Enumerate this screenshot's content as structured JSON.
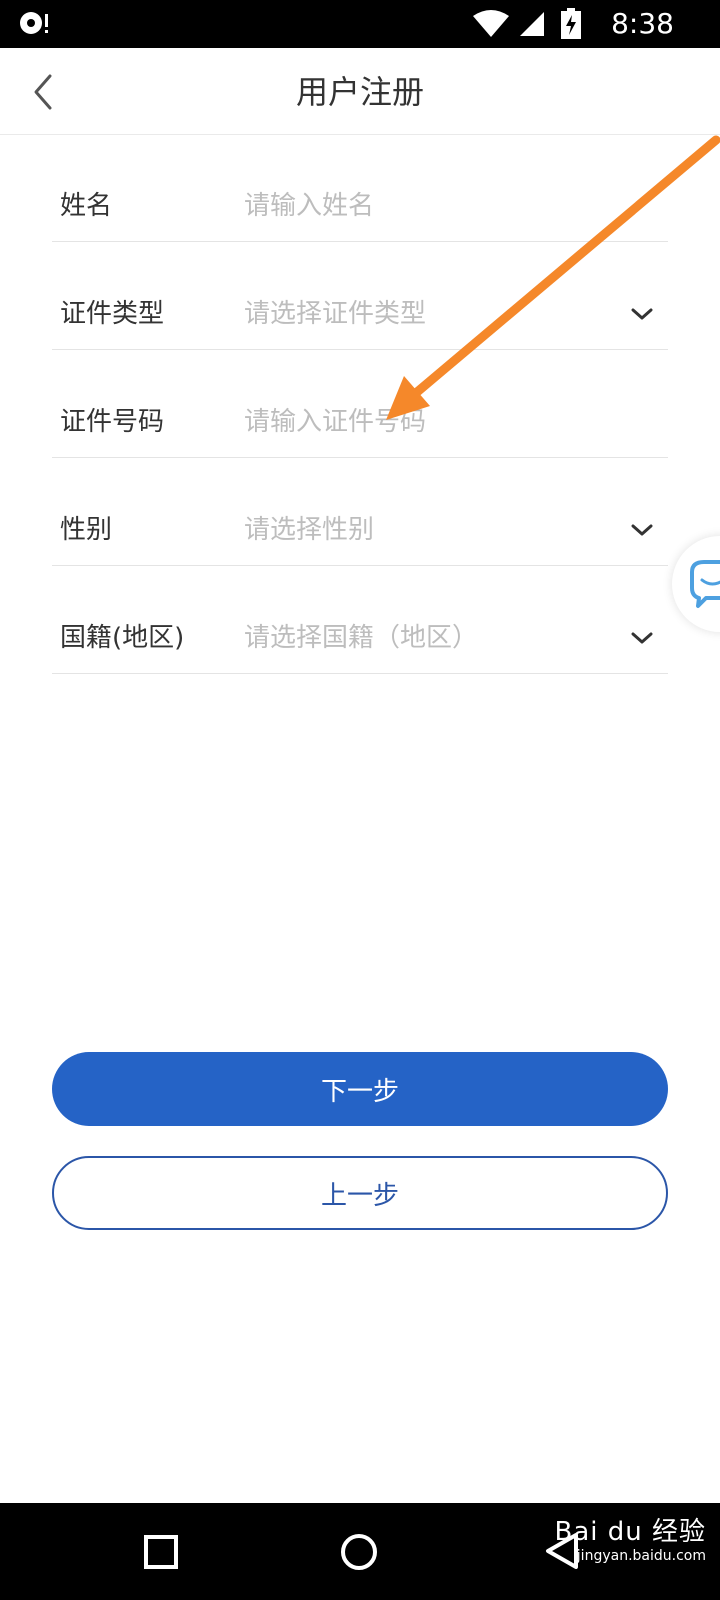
{
  "status_bar": {
    "time": "8:38",
    "icons": [
      "notification-icon",
      "wifi-icon",
      "signal-icon",
      "battery-charging-icon"
    ]
  },
  "header": {
    "title": "用户注册",
    "back_icon": "chevron-left-icon"
  },
  "form": {
    "fields": [
      {
        "label": "姓名",
        "placeholder": "请输入姓名",
        "type": "input"
      },
      {
        "label": "证件类型",
        "placeholder": "请选择证件类型",
        "type": "select"
      },
      {
        "label": "证件号码",
        "placeholder": "请输入证件号码",
        "type": "input"
      },
      {
        "label": "性别",
        "placeholder": "请选择性别",
        "type": "select"
      },
      {
        "label": "国籍(地区)",
        "placeholder": "请选择国籍（地区）",
        "type": "select"
      }
    ]
  },
  "buttons": {
    "next_label": "下一步",
    "prev_label": "上一步"
  },
  "floating": {
    "icon": "chat-bubble-icon"
  },
  "annotation": {
    "icon": "orange-arrow-annotation",
    "color": "#f5882a"
  },
  "system_nav": {
    "icons": [
      "recent-apps-icon",
      "home-icon",
      "back-icon"
    ]
  },
  "watermark": {
    "brand": "Bai du 经验",
    "site": "jingyan.baidu.com"
  },
  "colors": {
    "primary": "#2563c6",
    "secondary_border": "#2b56a8",
    "placeholder": "#bdbdbd",
    "label": "#333333"
  }
}
